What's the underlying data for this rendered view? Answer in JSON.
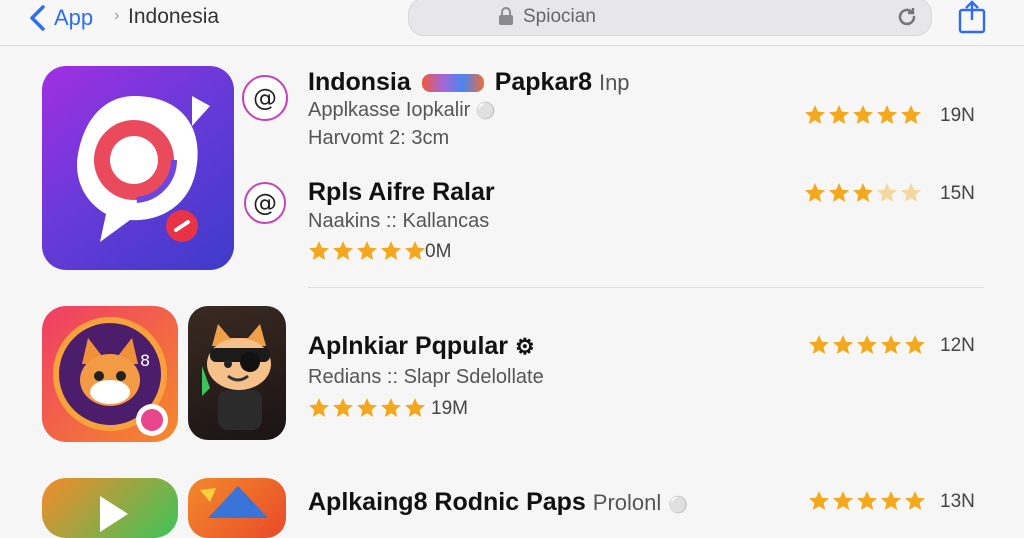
{
  "topbar": {
    "back_label": "App",
    "separator": "›",
    "breadcrumb": "Indonesia",
    "search_text": "Spiocian"
  },
  "items": [
    {
      "title_a": "Indonsia",
      "title_b": "Papkar8",
      "title_tail": "Inp",
      "subtitle": "Applkasse Iopkalir",
      "meta": "Harvomt 2: 3cm",
      "rating": 5,
      "count": "19N"
    },
    {
      "title": "Rpls Aifre Ralar",
      "subtitle": "Naakins :: Kallancas",
      "rating": 4.5,
      "count": "0M",
      "right_rating": 3,
      "right_count": "15N"
    },
    {
      "title": "Aplnkiar Pqpular",
      "subtitle": "Redians :: Slapr Sdelollate",
      "rating": 4.5,
      "count": "19M",
      "right_rating": 5,
      "right_count": "12N"
    },
    {
      "title": "Aplkaing8 Rodnic Paps",
      "title_tail": "Prolonl",
      "right_rating": 5,
      "right_count": "13N"
    }
  ],
  "colors": {
    "accent": "#2f6df0",
    "star": "#f3a81e",
    "badge_ring": "#c445b8"
  }
}
